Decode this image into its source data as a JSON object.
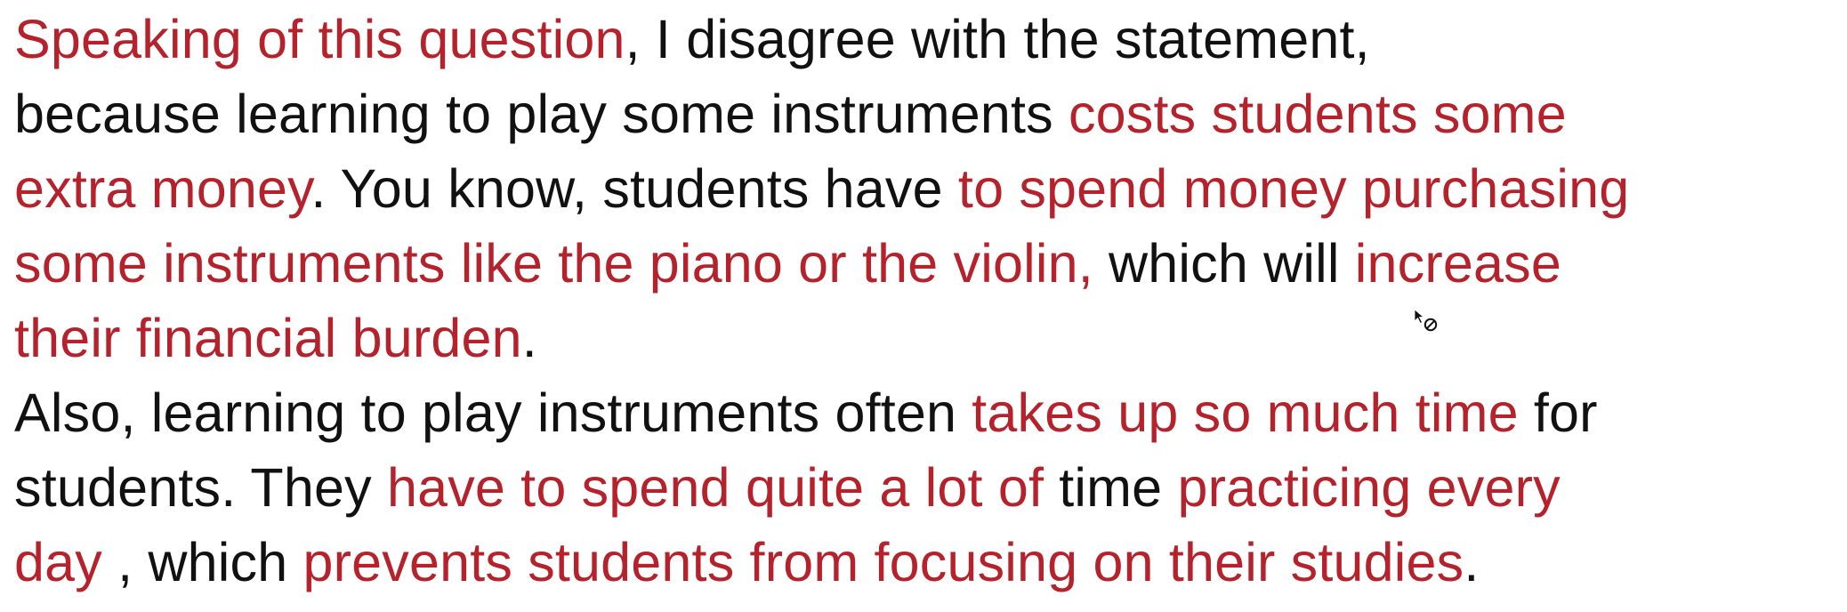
{
  "colors": {
    "highlight": "#b5222c",
    "text": "#111111",
    "background": "#ffffff"
  },
  "lines": [
    [
      {
        "t": "Speaking of this question",
        "c": "red"
      },
      {
        "t": ",  I disagree with the statement,",
        "c": "black"
      }
    ],
    [
      {
        "t": "because learning to play some instruments ",
        "c": "black"
      },
      {
        "t": "costs students some",
        "c": "red"
      }
    ],
    [
      {
        "t": "extra money",
        "c": "red"
      },
      {
        "t": ". You know, students  have ",
        "c": "black"
      },
      {
        "t": "to spend money purchasing",
        "c": "red"
      }
    ],
    [
      {
        "t": "some instruments like the piano or the violin,",
        "c": "red"
      },
      {
        "t": " which will ",
        "c": "black"
      },
      {
        "t": "increase",
        "c": "red"
      }
    ],
    [
      {
        "t": "their financial burden",
        "c": "red"
      },
      {
        "t": ".",
        "c": "black"
      }
    ],
    [
      {
        "t": "Also, learning to play instruments often ",
        "c": "black"
      },
      {
        "t": "takes up so much time",
        "c": "red"
      },
      {
        "t": " for",
        "c": "black"
      }
    ],
    [
      {
        "t": "students. They ",
        "c": "black"
      },
      {
        "t": "have to spend quite a lot of",
        "c": "red"
      },
      {
        "t": " time ",
        "c": "black"
      },
      {
        "t": "practicing every",
        "c": "red"
      }
    ],
    [
      {
        "t": "day",
        "c": "red"
      },
      {
        "t": " , which ",
        "c": "black"
      },
      {
        "t": "prevents students from focusing on their studies",
        "c": "red"
      },
      {
        "t": ".",
        "c": "black"
      }
    ]
  ],
  "cursor_icon": "pointer-with-no-entry-icon"
}
